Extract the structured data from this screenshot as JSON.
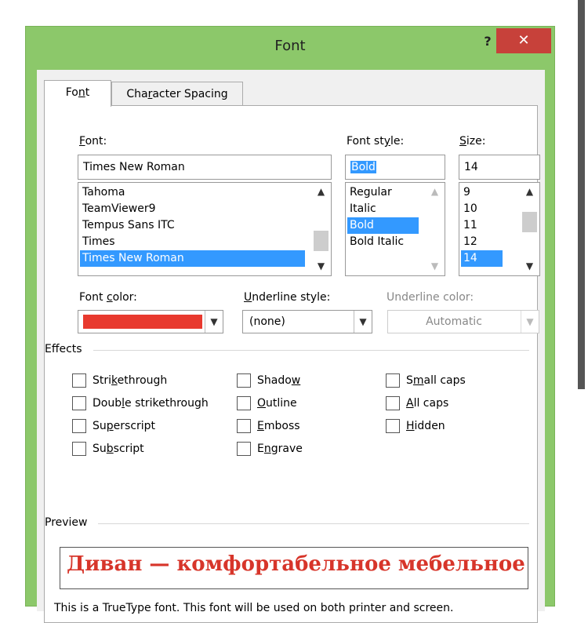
{
  "window": {
    "title": "Font",
    "help_label": "?",
    "close_label": "✕"
  },
  "tabs": [
    {
      "label_pre": "Fo",
      "accel": "n",
      "label_post": "t",
      "active": true
    },
    {
      "label_pre": "Cha",
      "accel": "r",
      "label_post": "acter Spacing",
      "active": false
    }
  ],
  "font": {
    "label_accel": "F",
    "label_rest": "ont:",
    "value": "Times New Roman",
    "list": [
      "Tahoma",
      "TeamViewer9",
      "Tempus Sans ITC",
      "Times",
      "Times New Roman"
    ],
    "selected": "Times New Roman"
  },
  "font_style": {
    "label_pre": "Font st",
    "label_accel": "y",
    "label_post": "le:",
    "value": "Bold",
    "list": [
      "Regular",
      "Italic",
      "Bold",
      "Bold Italic"
    ],
    "selected": "Bold"
  },
  "size": {
    "label_accel": "S",
    "label_rest": "ize:",
    "value": "14",
    "list": [
      "9",
      "10",
      "11",
      "12",
      "14"
    ],
    "selected": "14"
  },
  "font_color": {
    "label_pre": "Font ",
    "label_accel": "c",
    "label_post": "olor:",
    "swatch_color": "#e8392e"
  },
  "underline_style": {
    "label_accel": "U",
    "label_rest": "nderline style:",
    "value": "(none)"
  },
  "underline_color": {
    "label": "Underline color:",
    "value": "Automatic"
  },
  "effects": {
    "label": "Effects",
    "col1": [
      {
        "pre": "Stri",
        "accel": "k",
        "post": "ethrough",
        "checked": false
      },
      {
        "pre": "Doub",
        "accel": "l",
        "post": "e strikethrough",
        "checked": false
      },
      {
        "pre": "Su",
        "accel": "p",
        "post": "erscript",
        "checked": false
      },
      {
        "pre": "Su",
        "accel": "b",
        "post": "script",
        "checked": false
      }
    ],
    "col2": [
      {
        "pre": "Shado",
        "accel": "w",
        "post": "",
        "checked": false
      },
      {
        "pre": "",
        "accel": "O",
        "post": "utline",
        "checked": false
      },
      {
        "pre": "",
        "accel": "E",
        "post": "mboss",
        "checked": false
      },
      {
        "pre": "E",
        "accel": "n",
        "post": "grave",
        "checked": false
      }
    ],
    "col3": [
      {
        "pre": "S",
        "accel": "m",
        "post": "all caps",
        "checked": false
      },
      {
        "pre": "",
        "accel": "A",
        "post": "ll caps",
        "checked": false
      },
      {
        "pre": "",
        "accel": "H",
        "post": "idden",
        "checked": false
      }
    ]
  },
  "preview": {
    "label": "Preview",
    "sample_text": "Диван — комфортабельное мебельное из",
    "text_color": "#d7352a",
    "note": "This is a TrueType font. This font will be used on both printer and screen."
  }
}
